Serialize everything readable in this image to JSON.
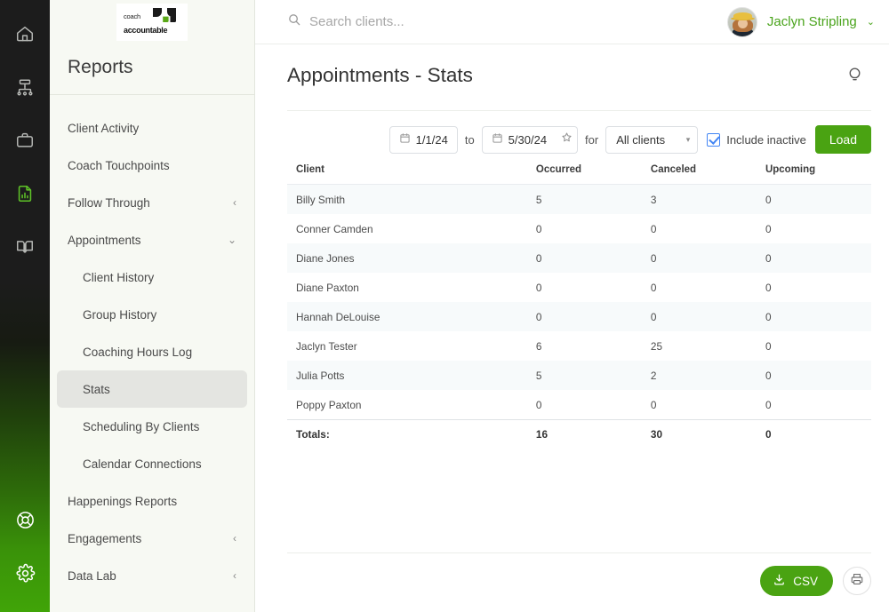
{
  "rail": {
    "items": [
      {
        "icon": "home-icon",
        "active": false
      },
      {
        "icon": "org-chart-icon",
        "active": false
      },
      {
        "icon": "briefcase-icon",
        "active": false
      },
      {
        "icon": "report-chart-icon",
        "active": true
      },
      {
        "icon": "book-icon",
        "active": false
      }
    ],
    "bottom_items": [
      {
        "icon": "life-ring-icon"
      },
      {
        "icon": "gear-icon"
      }
    ],
    "active_color": "#5ec227"
  },
  "logo": {
    "line1": "coach",
    "line2": "accountable",
    "leaf_green": "#5aa817",
    "leaf_dark": "#1a1a1a"
  },
  "sidebar": {
    "title": "Reports",
    "items": [
      {
        "label": "Client Activity",
        "indent": false,
        "chevron": "",
        "active": false
      },
      {
        "label": "Coach Touchpoints",
        "indent": false,
        "chevron": "",
        "active": false
      },
      {
        "label": "Follow Through",
        "indent": false,
        "chevron": "‹",
        "active": false
      },
      {
        "label": "Appointments",
        "indent": false,
        "chevron": "⌄",
        "active": false
      },
      {
        "label": "Client History",
        "indent": true,
        "chevron": "",
        "active": false
      },
      {
        "label": "Group History",
        "indent": true,
        "chevron": "",
        "active": false
      },
      {
        "label": "Coaching Hours Log",
        "indent": true,
        "chevron": "",
        "active": false
      },
      {
        "label": "Stats",
        "indent": true,
        "chevron": "",
        "active": true
      },
      {
        "label": "Scheduling By Clients",
        "indent": true,
        "chevron": "",
        "active": false
      },
      {
        "label": "Calendar Connections",
        "indent": true,
        "chevron": "",
        "active": false
      },
      {
        "label": "Happenings Reports",
        "indent": false,
        "chevron": "",
        "active": false
      },
      {
        "label": "Engagements",
        "indent": false,
        "chevron": "‹",
        "active": false
      },
      {
        "label": "Data Lab",
        "indent": false,
        "chevron": "‹",
        "active": false
      }
    ]
  },
  "topbar": {
    "search_placeholder": "Search clients...",
    "search_icon": "search-icon",
    "user_name": "Jaclyn Stripling",
    "user_caret": "⌄",
    "user_name_color": "#4aa41c"
  },
  "page": {
    "title": "Appointments - Stats",
    "tips_icon": "lightbulb-icon"
  },
  "toolbar": {
    "date_from": "1/1/24",
    "date_to": "5/30/24",
    "between_label": "to",
    "for_label": "for",
    "star_icon": "star-icon",
    "calendar_icon": "calendar-icon",
    "client_filter": "All clients",
    "client_filter_caret": "▾",
    "include_inactive_label": "Include inactive",
    "include_inactive_checked": true,
    "load_label": "Load",
    "load_color": "#4aa312"
  },
  "chart_data": {
    "type": "table",
    "title": "Appointments - Stats",
    "columns": [
      "Client",
      "Occurred",
      "Canceled",
      "Upcoming"
    ],
    "rows": [
      [
        "Billy Smith",
        "5",
        "3",
        "0"
      ],
      [
        "Conner Camden",
        "0",
        "0",
        "0"
      ],
      [
        "Diane Jones",
        "0",
        "0",
        "0"
      ],
      [
        "Diane Paxton",
        "0",
        "0",
        "0"
      ],
      [
        "Hannah DeLouise",
        "0",
        "0",
        "0"
      ],
      [
        "Jaclyn Tester",
        "6",
        "25",
        "0"
      ],
      [
        "Julia Potts",
        "5",
        "2",
        "0"
      ],
      [
        "Poppy Paxton",
        "0",
        "0",
        "0"
      ]
    ],
    "totals_row": [
      "Totals:",
      "16",
      "30",
      "0"
    ]
  },
  "footer": {
    "csv_label": "CSV",
    "csv_icon": "download-icon",
    "print_icon": "printer-icon",
    "csv_color": "#4aa312"
  }
}
